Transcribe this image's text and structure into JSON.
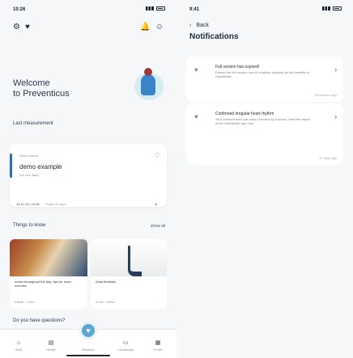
{
  "left": {
    "status_time": "10:26",
    "welcome_line1": "Welcome",
    "welcome_line2": "to Preventicus",
    "last_measurement_title": "Last measurement",
    "measurement": {
      "small_top": "Heart rhythm",
      "main": "demo example",
      "small_bottom": "(no real data)",
      "date": "13.11.24 | 10:26",
      "pulse": "Pulse: 62 bpm"
    },
    "things_title": "Things to know",
    "show_all": "show all",
    "tips": [
      {
        "text": "Active throughout the day: tips for more exercise",
        "meta": "Article · 2 min"
      },
      {
        "text": "Atrial fibrillatio",
        "meta": "5 min · article"
      }
    ],
    "questions": "Do you have questions?",
    "tabs": [
      "Start",
      "Health",
      "Measure",
      "Knowledge",
      "Profile"
    ]
  },
  "right": {
    "status_time": "9:41",
    "back_label": "Back",
    "title": "Notifications",
    "notifications": [
      {
        "title": "Full version has expired!",
        "body": "Extend the full version now to continue enjoying all the benefits of Heartbeats.",
        "time": "35 minutes ago"
      },
      {
        "title": "Confirmed irregular heart rhythm",
        "body": "Your measurement has been checked by a doctor. View the report in the Heartbeats app now.",
        "time": "12 days ago"
      }
    ]
  },
  "colors": {
    "accent": "#2a6fb8",
    "fab": "#5aa7d6"
  }
}
